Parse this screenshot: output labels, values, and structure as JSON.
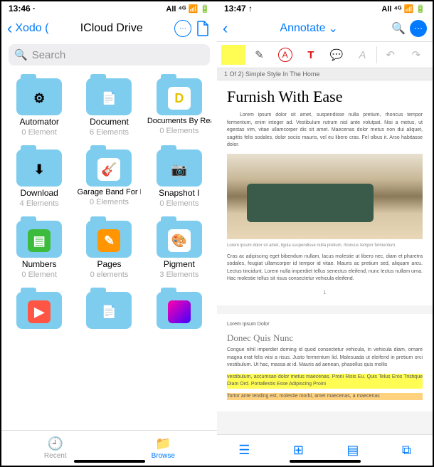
{
  "left": {
    "status": {
      "time": "13:46 ·",
      "right": "All ⁴ᴳ 📶 🔋"
    },
    "nav": {
      "back": "Xodo (",
      "title": "ICloud Drive"
    },
    "search": {
      "placeholder": "Search"
    },
    "folders": [
      {
        "name": "Automator",
        "sub": "0 Element",
        "icon": "gear",
        "bg": ""
      },
      {
        "name": "Document",
        "sub": "6 Elements",
        "icon": "doc",
        "bg": ""
      },
      {
        "name": "Documents By Readdle",
        "sub": "0 Elements",
        "icon": "D",
        "bg": "#fff",
        "color": "#e8c000"
      },
      {
        "name": "Download",
        "sub": "4 Elements",
        "icon": "download",
        "bg": ""
      },
      {
        "name": "Garage Band For IOS",
        "sub": "0 Elements",
        "icon": "🎸",
        "bg": "#fff"
      },
      {
        "name": "Snapshot I",
        "sub": "0 Elements",
        "icon": "cam",
        "bg": ""
      },
      {
        "name": "Numbers",
        "sub": "0 Element",
        "icon": "📊",
        "bg": "#fff",
        "fill": "#3dbb3d"
      },
      {
        "name": "Pages",
        "sub": "0 elements",
        "icon": "✎",
        "bg": "#fff",
        "fill": "#ff9500"
      },
      {
        "name": "Pigment",
        "sub": "3 Elements",
        "icon": "🎨",
        "bg": "#fff"
      }
    ],
    "partialRow": [
      {
        "icon": "📷",
        "bg": "#fff",
        "fill": "#f54"
      },
      {
        "icon": "doc",
        "bg": ""
      },
      {
        "icon": "⬛",
        "bg": "#fff"
      }
    ],
    "tabs": {
      "recent": "Recent",
      "browse": "Browse"
    }
  },
  "right": {
    "status": {
      "time": "13:47 ↑",
      "right": "All ⁴ᴳ 📶 🔋"
    },
    "nav": {
      "title": "Annotate"
    },
    "strip": "1 Of 2) Simple Style In The Home",
    "h1": "Furnish With Ease",
    "p1": "Lorem ipsum dolor sit amet, suspendisse nulla pretium, rhoncus tempor fermentum, enim integer ad. Vestibulum rutrum nisl ante volutpat. Nisi a metus, ut egestas vim, vitae ullamcorper dis sit amet. Maecenas dolor metus non dui aliquet, sagittis felis sodales, dolor sociis mauris, vel eu libero cras. Fel olbus it. Arso habitasse dolor.",
    "caption": "Lorem ipsum dolor sit amet, ligula suspendisse nulla pretium, rhoncus tempor fermentum.",
    "p2": "Cras ac adipiscing eget bibendum nullam, lacus molestie ut libero nec, diam et pharetra sodales, feugiat ullamcorper id tempor id vitae. Mauris ac pretium sed, aliquam arcu. Lectus tincidunt. Lorem nulla imperdiet tellus senectus eleifend, nunc lectus nullam urna. Hac molestie tellus sit risus consectetur vehicula eleifend.",
    "pagenum": "1",
    "p3": "Lorem Ipsum Dolor",
    "h2": "Donec Quis Nunc",
    "p4": "Congue nihil imperdiet doming id quod consectetur vehicula, in vehicula diam, ornare magna erat felis wisi a risus. Justo fermentum lid. Malesuada ut eleifend in pretium orci vestibulum. Ut hac, massa at id. Mauris ad aenean, phasellus quis mollis",
    "p5": "vestibulum, accumsan dolor metus maecenas. Proni Risis Eu. Quis Telus Eros Tristique Diam Ord. Portallestis Esse Adipiscing Proini",
    "p6": "Tortor ante tending est, molestie morbi, amet maecenas, a maecenas"
  }
}
